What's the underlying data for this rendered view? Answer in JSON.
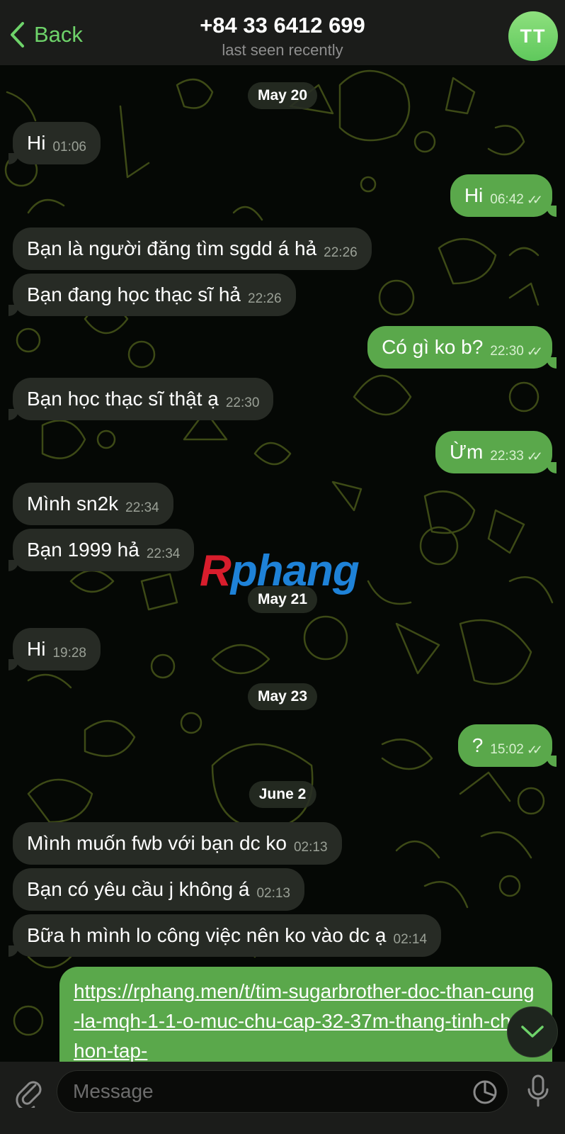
{
  "header": {
    "back_label": "Back",
    "title": "+84 33 6412 699",
    "status": "last seen recently",
    "avatar_initials": "TT"
  },
  "messages": [
    {
      "kind": "date",
      "text": "May 20"
    },
    {
      "kind": "in",
      "text": "Hi",
      "time": "01:06"
    },
    {
      "kind": "out",
      "text": "Hi",
      "time": "06:42",
      "read": true
    },
    {
      "kind": "in",
      "text": "Bạn là người đăng tìm sgdd á hả",
      "time": "22:26"
    },
    {
      "kind": "in",
      "text": "Bạn đang học thạc sĩ hả",
      "time": "22:26"
    },
    {
      "kind": "out",
      "text": "Có gì ko b?",
      "time": "22:30",
      "read": true
    },
    {
      "kind": "in",
      "text": "Bạn học thạc sĩ thật ạ",
      "time": "22:30"
    },
    {
      "kind": "out",
      "text": "Ừm",
      "time": "22:33",
      "read": true
    },
    {
      "kind": "in",
      "text": "Mình sn2k",
      "time": "22:34"
    },
    {
      "kind": "in",
      "text": "Bạn 1999 hả",
      "time": "22:34"
    },
    {
      "kind": "date",
      "text": "May 21"
    },
    {
      "kind": "in",
      "text": "Hi",
      "time": "19:28"
    },
    {
      "kind": "date",
      "text": "May 23"
    },
    {
      "kind": "out",
      "text": "?",
      "time": "15:02",
      "read": true
    },
    {
      "kind": "date",
      "text": "June 2"
    },
    {
      "kind": "in",
      "text": "Mình muốn fwb với bạn dc ko",
      "time": "02:13"
    },
    {
      "kind": "in",
      "text": "Bạn có yêu cầu j không á",
      "time": "02:13"
    },
    {
      "kind": "in",
      "text": "Bữa h mình lo công việc nên ko vào dc ạ",
      "time": "02:14"
    }
  ],
  "link_message": {
    "text": "https://rphang.men/t/tim-sugarbrother-doc-than-cung-la-mqh-1-1-o-muc-chu-cap-32-37m-thang-tinh-chat-hon-tap-"
  },
  "watermark": {
    "part1": "R",
    "part2": "phang"
  },
  "composer": {
    "placeholder": "Message"
  },
  "colors": {
    "accent": "#6ed36a",
    "outgoing_bubble": "#5aa84b",
    "incoming_bubble": "#272b25",
    "header_bg": "#1b1c1a"
  },
  "icons": [
    "chevron-left-icon",
    "paperclip-icon",
    "sticker-icon",
    "microphone-icon",
    "chevron-down-icon",
    "double-check-icon"
  ]
}
